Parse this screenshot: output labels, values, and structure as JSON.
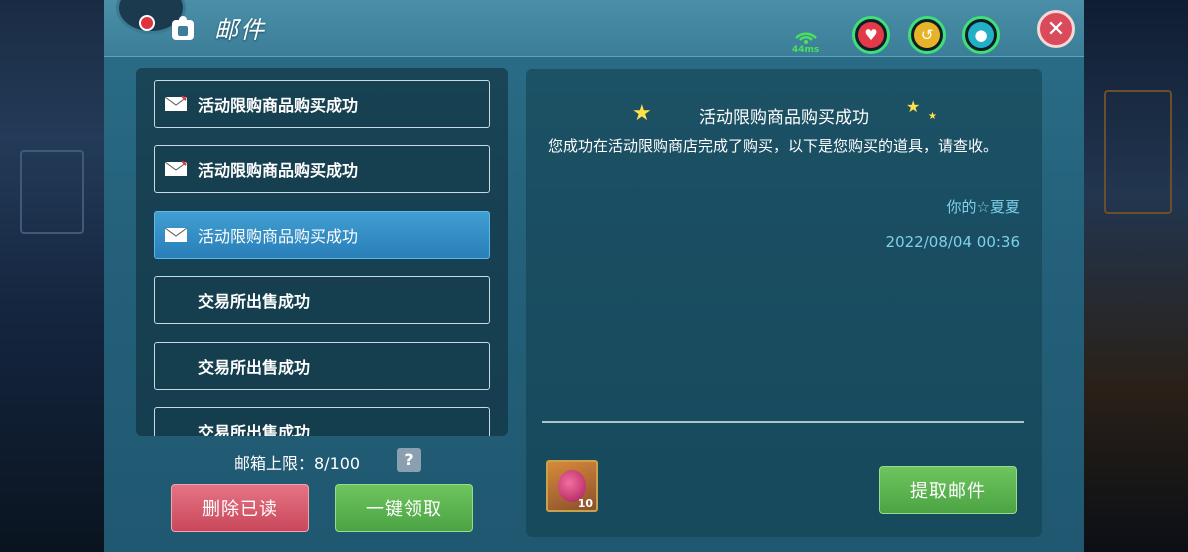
{
  "header": {
    "title": "邮件",
    "ping": "44ms"
  },
  "mail_list": [
    {
      "label": "活动限购商品购买成功",
      "has_icon": true,
      "selected": false
    },
    {
      "label": "活动限购商品购买成功",
      "has_icon": true,
      "selected": false
    },
    {
      "label": "活动限购商品购买成功",
      "has_icon": true,
      "selected": true
    },
    {
      "label": "交易所出售成功",
      "has_icon": false,
      "selected": false
    },
    {
      "label": "交易所出售成功",
      "has_icon": false,
      "selected": false
    },
    {
      "label": "交易所出售成功",
      "has_icon": false,
      "selected": false
    }
  ],
  "mailbox": {
    "capacity_label": "邮箱上限：8/100",
    "help_label": "?"
  },
  "buttons": {
    "delete_read": "删除已读",
    "claim_all": "一键领取",
    "extract": "提取邮件"
  },
  "detail": {
    "title": "活动限购商品购买成功",
    "body": "您成功在活动限购商店完成了购买，以下是您购买的道具，请查收。",
    "sender": "你的☆夏夏",
    "date": "2022/08/04 00:36",
    "attachment_qty": "10"
  },
  "colors": {
    "ring_green": "#3fe07a",
    "delete_red": "#d9586c",
    "claim_green": "#5cb451",
    "selected_blue": "#3590c8"
  }
}
